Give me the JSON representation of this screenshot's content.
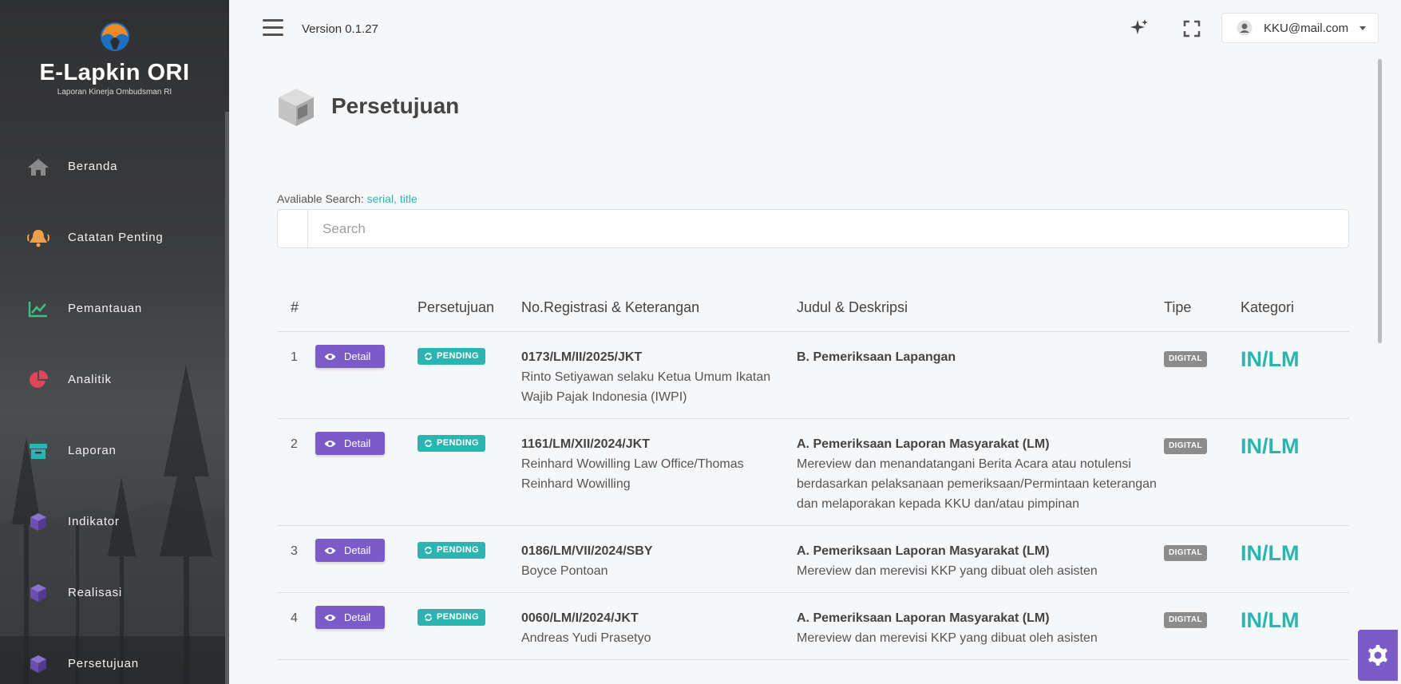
{
  "brand": {
    "title": "E-Lapkin ORI",
    "subtitle": "Laporan Kinerja Ombudsman RI"
  },
  "sidebar": {
    "items": [
      {
        "label": "Beranda",
        "icon": "home-icon",
        "color": "#8a8a8a"
      },
      {
        "label": "Catatan Penting",
        "icon": "bell-icon",
        "color": "#f0a04b"
      },
      {
        "label": "Pemantauan",
        "icon": "line-chart-icon",
        "color": "#3fbf7f"
      },
      {
        "label": "Analitik",
        "icon": "pie-chart-icon",
        "color": "#e0455a"
      },
      {
        "label": "Laporan",
        "icon": "archive-icon",
        "color": "#2bb5b0"
      },
      {
        "label": "Indikator",
        "icon": "cube-icon",
        "color": "#6a4fb0"
      },
      {
        "label": "Realisasi",
        "icon": "cube-icon",
        "color": "#6a4fb0"
      },
      {
        "label": "Persetujuan",
        "icon": "cube-icon",
        "color": "#6a4fb0"
      }
    ]
  },
  "topbar": {
    "version": "Version 0.1.27",
    "user_email": "KKU@mail.com"
  },
  "page": {
    "title": "Persetujuan"
  },
  "search": {
    "hint_label": "Avaliable Search:",
    "hint_fields": "serial, title",
    "placeholder": "Search"
  },
  "table": {
    "headers": {
      "num": "#",
      "approval": "Persetujuan",
      "registration": "No.Registrasi & Keterangan",
      "title": "Judul & Deskripsi",
      "type": "Tipe",
      "category": "Kategori"
    },
    "detail_label": "Detail",
    "rows": [
      {
        "num": "1",
        "status": "PENDING",
        "reg_no": "0173/LM/II/2025/JKT",
        "reg_desc": "Rinto Setiyawan selaku Ketua Umum Ikatan Wajib Pajak Indonesia (IWPI)",
        "title": "B. Pemeriksaan Lapangan",
        "description": "",
        "type": "DIGITAL",
        "category": "IN/LM"
      },
      {
        "num": "2",
        "status": "PENDING",
        "reg_no": "1161/LM/XII/2024/JKT",
        "reg_desc": "Reinhard Wowilling Law Office/Thomas Reinhard Wowilling",
        "title": "A. Pemeriksaan Laporan Masyarakat (LM)",
        "description": "Mereview dan menandatangani Berita Acara atau notulensi berdasarkan pelaksanaan pemeriksaan/Permintaan keterangan dan melaporakan kepada KKU dan/atau pimpinan",
        "type": "DIGITAL",
        "category": "IN/LM"
      },
      {
        "num": "3",
        "status": "PENDING",
        "reg_no": "0186/LM/VII/2024/SBY",
        "reg_desc": "Boyce Pontoan",
        "title": "A. Pemeriksaan Laporan Masyarakat (LM)",
        "description": "Mereview dan merevisi KKP yang dibuat oleh asisten",
        "type": "DIGITAL",
        "category": "IN/LM"
      },
      {
        "num": "4",
        "status": "PENDING",
        "reg_no": "0060/LM/I/2024/JKT",
        "reg_desc": "Andreas Yudi Prasetyo",
        "title": "A. Pemeriksaan Laporan Masyarakat (LM)",
        "description": "Mereview dan merevisi KKP yang dibuat oleh asisten",
        "type": "DIGITAL",
        "category": "IN/LM"
      }
    ]
  },
  "colors": {
    "accent_teal": "#2bb5b0",
    "accent_purple": "#7b5bc7",
    "badge_gray": "#8c8c8c"
  }
}
